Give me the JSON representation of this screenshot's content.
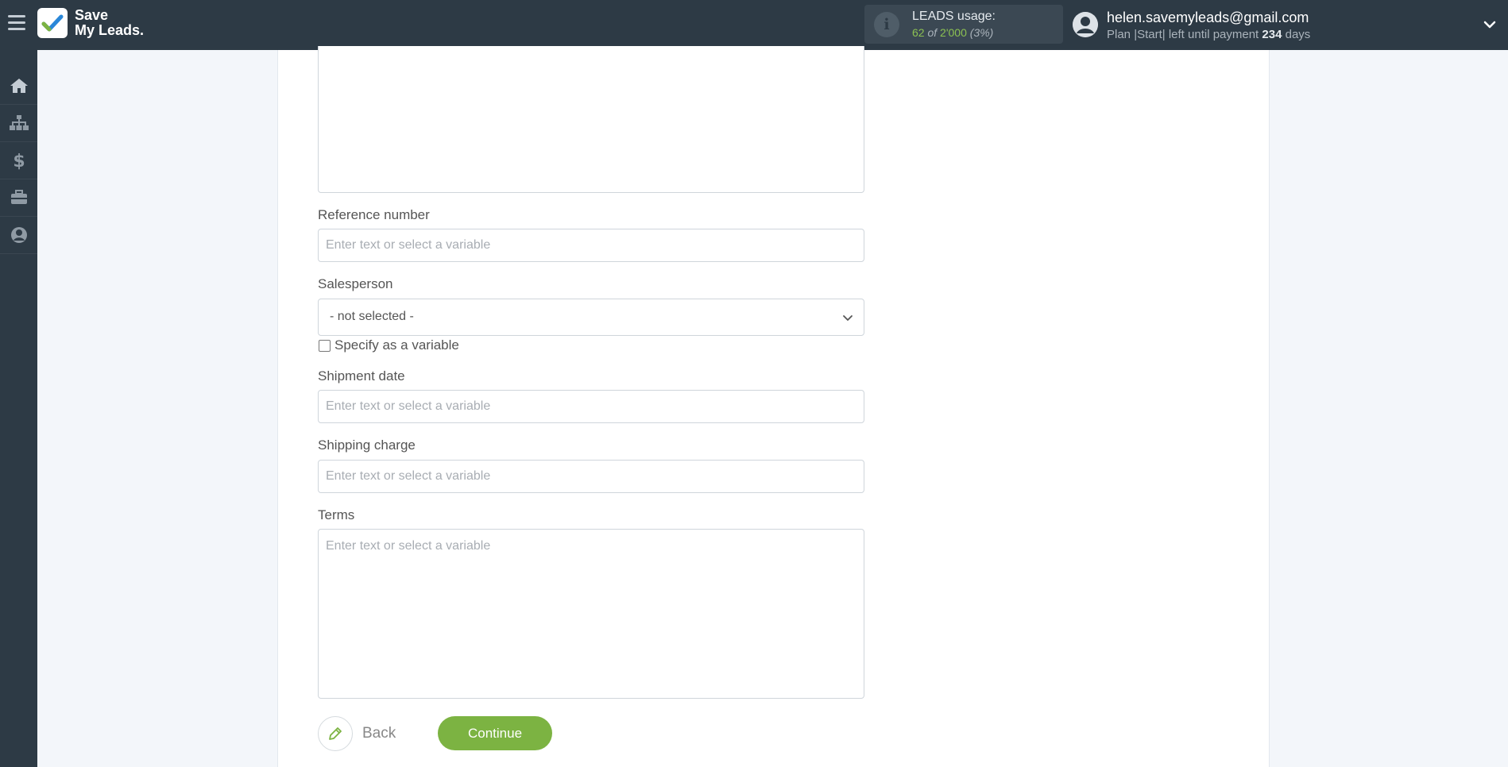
{
  "brand": {
    "line1": "Save",
    "line2": "My Leads."
  },
  "usage": {
    "title": "LEADS usage:",
    "used": "62",
    "of_word": "of",
    "limit": "2'000",
    "percent": "(3%)"
  },
  "user": {
    "email": "helen.savemyleads@gmail.com",
    "plan_prefix": "Plan |Start| left until payment",
    "days": "234",
    "days_suffix": "days"
  },
  "sidebar": {
    "items": [
      "home-icon",
      "sitemap-icon",
      "dollar-icon",
      "briefcase-icon",
      "user-circle-icon"
    ]
  },
  "form": {
    "reference_number": {
      "label": "Reference number",
      "placeholder": "Enter text or select a variable"
    },
    "salesperson": {
      "label": "Salesperson",
      "value": "- not selected -",
      "variable_label": "Specify as a variable"
    },
    "shipment_date": {
      "label": "Shipment date",
      "placeholder": "Enter text or select a variable"
    },
    "shipping_charge": {
      "label": "Shipping charge",
      "placeholder": "Enter text or select a variable"
    },
    "terms": {
      "label": "Terms",
      "placeholder": "Enter text or select a variable"
    }
  },
  "actions": {
    "back": "Back",
    "continue": "Continue"
  },
  "colors": {
    "topbar": "#2d3a45",
    "accent_green": "#7cb342",
    "usage_green": "#8cc152"
  }
}
